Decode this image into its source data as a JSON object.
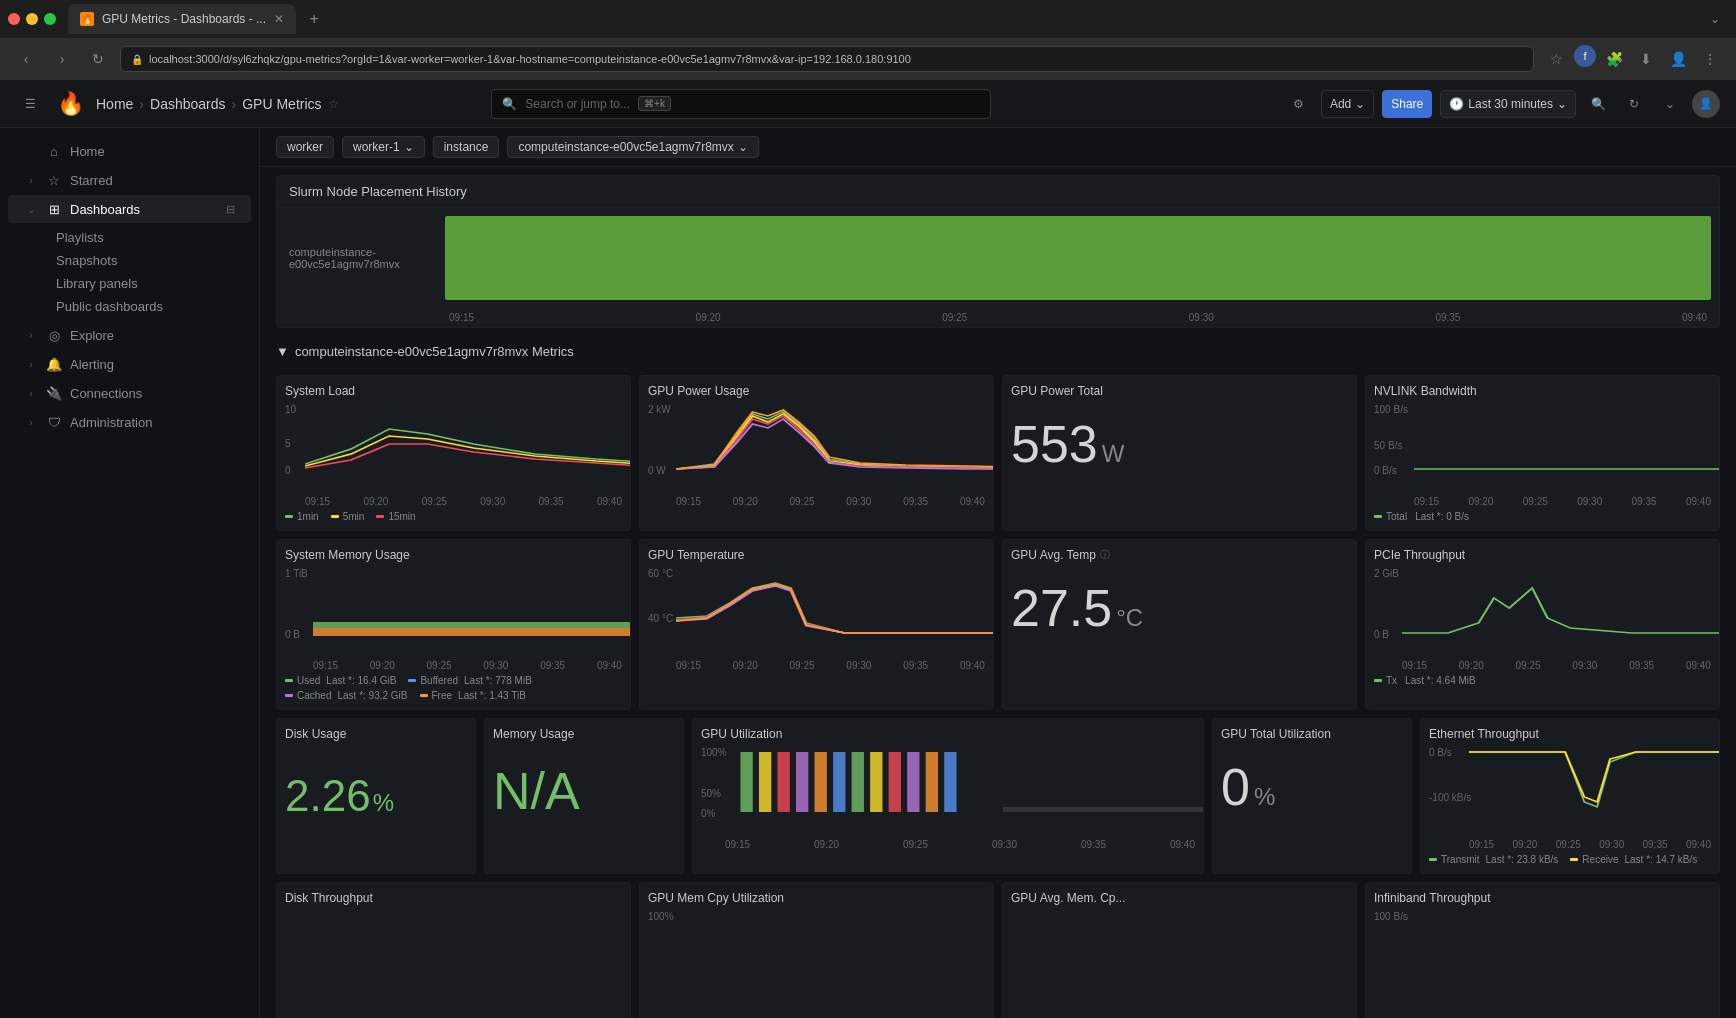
{
  "browser": {
    "tab_title": "GPU Metrics - Dashboards - ...",
    "url": "localhost:3000/d/syl6zhqkz/gpu-metrics?orgId=1&var-worker=worker-1&var-hostname=computeinstance-e00vc5e1agmv7r8mvx&var-ip=192.168.0.180:9100",
    "new_tab": "+"
  },
  "header": {
    "breadcrumbs": [
      "Home",
      "Dashboards",
      "GPU Metrics"
    ],
    "search_placeholder": "Search or jump to...",
    "search_shortcut": "⌘+k",
    "add_label": "Add",
    "share_label": "Share",
    "time_range": "Last 30 minutes"
  },
  "sidebar": {
    "items": [
      {
        "label": "Home",
        "icon": "home"
      },
      {
        "label": "Starred",
        "icon": "star"
      },
      {
        "label": "Dashboards",
        "icon": "grid",
        "active": true
      },
      {
        "label": "Playlists",
        "sub": true
      },
      {
        "label": "Snapshots",
        "sub": true
      },
      {
        "label": "Library panels",
        "sub": true
      },
      {
        "label": "Public dashboards",
        "sub": true
      },
      {
        "label": "Explore",
        "icon": "compass"
      },
      {
        "label": "Alerting",
        "icon": "bell"
      },
      {
        "label": "Connections",
        "icon": "plug"
      },
      {
        "label": "Administration",
        "icon": "shield"
      }
    ]
  },
  "toolbar": {
    "worker_label": "worker",
    "worker_value": "worker-1",
    "instance_label": "instance",
    "instance_value": "computeinstance-e00vc5e1agmv7r8mvx"
  },
  "slurm": {
    "title": "Slurm Node Placement History",
    "node_label": "computeinstance-e00vc5e1agmv7r8mvx",
    "times": [
      "09:15",
      "09:20",
      "09:25",
      "09:30",
      "09:35",
      "09:40"
    ]
  },
  "metrics_section": {
    "title": "computeinstance-e00vc5e1agmv7r8mvx Metrics"
  },
  "panels": {
    "system_load": {
      "title": "System Load",
      "y_max": "10",
      "y_mid": "5",
      "y_min": "0",
      "times": [
        "09:15",
        "09:20",
        "09:25",
        "09:30",
        "09:35",
        "09:40"
      ],
      "legend": [
        "1min",
        "5min",
        "15min"
      ]
    },
    "gpu_power_usage": {
      "title": "GPU Power Usage",
      "y_max": "2 kW",
      "y_min": "0 W",
      "times": [
        "09:15",
        "09:20",
        "09:25",
        "09:30",
        "09:35",
        "09:40"
      ]
    },
    "gpu_power_total": {
      "title": "GPU Power Total",
      "value": "553",
      "unit": "W"
    },
    "nvlink_bandwidth": {
      "title": "NVLINK Bandwidth",
      "y_max": "100 B/s",
      "y_mid": "50 B/s",
      "y_min": "0 B/s",
      "times": [
        "09:15",
        "09:20",
        "09:25",
        "09:30",
        "09:35",
        "09:40"
      ],
      "legend_label": "Total",
      "legend_last": "Last *: 0 B/s"
    },
    "system_memory": {
      "title": "System Memory Usage",
      "y_max": "1 TiB",
      "y_min": "0 B",
      "times": [
        "09:15",
        "09:20",
        "09:25",
        "09:30",
        "09:35",
        "09:40"
      ],
      "legend": [
        {
          "label": "Used",
          "last": "Last *: 16.4 GiB",
          "color": "#73bf69"
        },
        {
          "label": "Buffered",
          "last": "Last *: 778 MiB",
          "color": "#5794f2"
        },
        {
          "label": "Cached",
          "last": "Last *: 93.2 GiB",
          "color": "#b877d9"
        },
        {
          "label": "Free",
          "last": "Last *: 1.43 TiB",
          "color": "#ff9830"
        }
      ]
    },
    "gpu_temperature": {
      "title": "GPU Temperature",
      "y_max": "60 °C",
      "y_mid": "40 °C",
      "times": [
        "09:15",
        "09:20",
        "09:25",
        "09:30",
        "09:35",
        "09:40"
      ]
    },
    "gpu_avg_temp": {
      "title": "GPU Avg. Temp",
      "value": "27.5",
      "unit": "°C",
      "has_info": true
    },
    "pcie_throughput": {
      "title": "PCIe Throughput",
      "y_max": "2 GiB",
      "y_min": "0 B",
      "times": [
        "09:15",
        "09:20",
        "09:25",
        "09:30",
        "09:35",
        "09:40"
      ],
      "legend_label": "Tx",
      "legend_last": "Last *: 4.64 MiB"
    },
    "disk_usage": {
      "title": "Disk Usage",
      "value": "2.26",
      "unit": "%"
    },
    "memory_usage": {
      "title": "Memory Usage",
      "value": "N/A"
    },
    "gpu_utilization": {
      "title": "GPU Utilization",
      "y_max": "100%",
      "y_mid": "50%",
      "y_min": "0%",
      "times": [
        "09:15",
        "09:20",
        "09:25",
        "09:30",
        "09:35",
        "09:40"
      ]
    },
    "gpu_total_utilization": {
      "title": "GPU Total Utilization",
      "value": "0",
      "unit": "%"
    },
    "ethernet_throughput": {
      "title": "Ethernet Throughput",
      "y_max": "0 B/s",
      "y_mid": "-100 kB/s",
      "times": [
        "09:15",
        "09:20",
        "09:25",
        "09:30",
        "09:35",
        "09:40"
      ],
      "legend": [
        {
          "label": "Transmit",
          "last": "Last *: 23.8 kB/s",
          "color": "#73bf69"
        },
        {
          "label": "Receive",
          "last": "Last *: 14.7 kB/s",
          "color": "#fade2a"
        }
      ]
    },
    "disk_throughput": {
      "title": "Disk Throughput"
    },
    "gpu_mem_cpy": {
      "title": "GPU Mem Cpy Utilization",
      "y_max": "100%"
    },
    "gpu_avg_mem": {
      "title": "GPU Avg. Mem. Cp..."
    },
    "infiniband": {
      "title": "Infiniband Throughput",
      "y_max": "100 B/s"
    }
  }
}
